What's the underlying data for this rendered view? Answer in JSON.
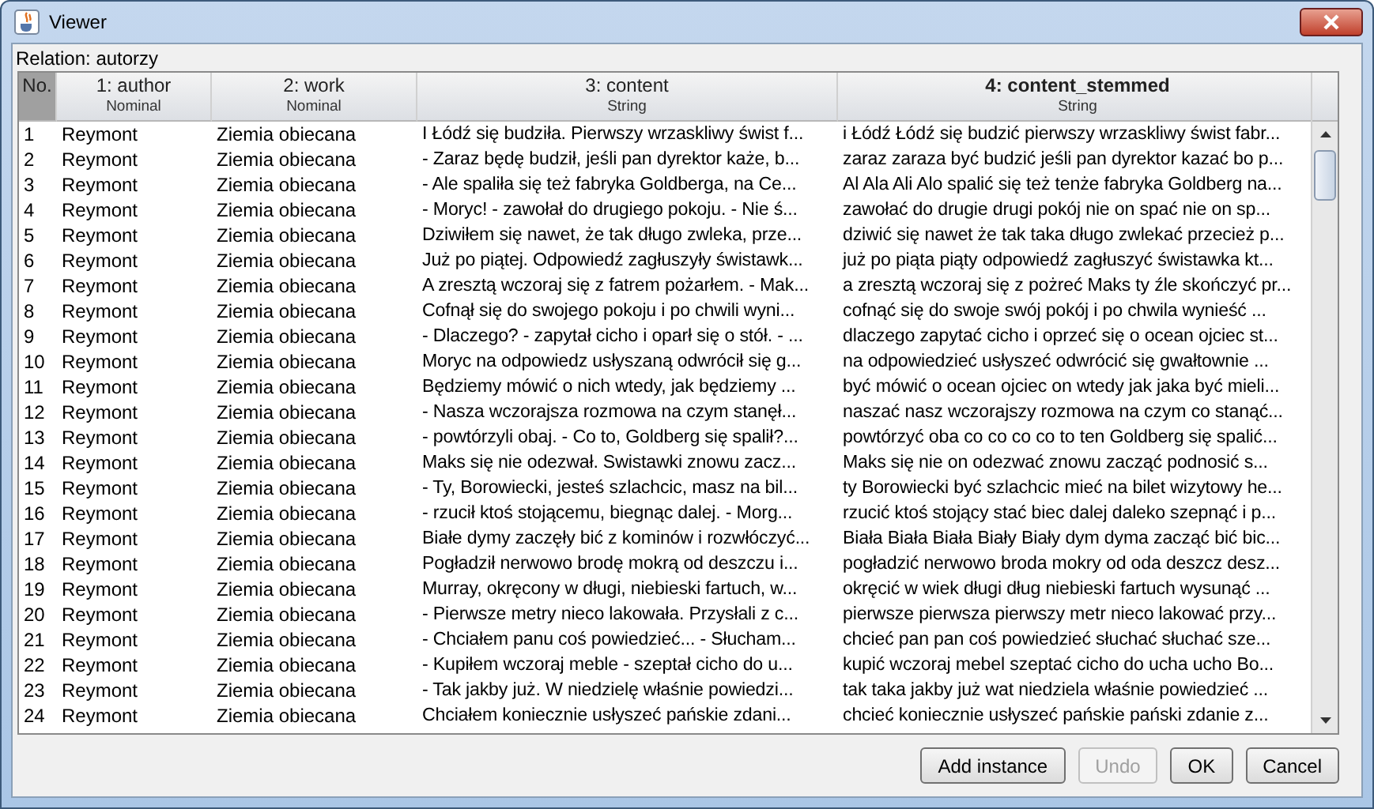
{
  "window": {
    "title": "Viewer"
  },
  "relation": "Relation: autorzy",
  "table": {
    "columns": [
      {
        "name": "No.",
        "selected": false
      },
      {
        "name": "1: author",
        "type": "Nominal",
        "selected": false
      },
      {
        "name": "2: work",
        "type": "Nominal",
        "selected": false
      },
      {
        "name": "3: content",
        "type": "String",
        "selected": false
      },
      {
        "name": "4: content_stemmed",
        "type": "String",
        "selected": true
      }
    ],
    "rows": [
      [
        "1",
        "Reymont",
        "Ziemia obiecana",
        "I Łódź się budziła. Pierwszy wrzaskliwy świst f...",
        "i Łódź Łódź się budzić pierwszy wrzaskliwy świst fabr..."
      ],
      [
        "2",
        "Reymont",
        "Ziemia obiecana",
        "- Zaraz będę budził, jeśli pan dyrektor każe, b...",
        "zaraz zaraza być budzić jeśli pan dyrektor kazać bo p..."
      ],
      [
        "3",
        "Reymont",
        "Ziemia obiecana",
        "- Ale spaliła się też fabryka Goldberga, na Ce...",
        "Al Ala Ali Alo spalić się też tenże fabryka Goldberg na..."
      ],
      [
        "4",
        "Reymont",
        "Ziemia obiecana",
        "- Moryc! - zawołał do drugiego pokoju. - Nie ś...",
        "zawołać do drugie drugi pokój nie on spać nie on sp..."
      ],
      [
        "5",
        "Reymont",
        "Ziemia obiecana",
        "Dziwiłem się nawet, że tak długo zwleka, prze...",
        "dziwić się nawet że tak taka długo zwlekać przecież p..."
      ],
      [
        "6",
        "Reymont",
        "Ziemia obiecana",
        "Już po piątej. Odpowiedź zagłuszyły świstawk...",
        "już po piąta piąty odpowiedź zagłuszyć świstawka kt..."
      ],
      [
        "7",
        "Reymont",
        "Ziemia obiecana",
        "A zresztą wczoraj się z fatrem pożarłem. - Mak...",
        "a zresztą wczoraj się z pożreć Maks ty źle skończyć pr..."
      ],
      [
        "8",
        "Reymont",
        "Ziemia obiecana",
        "Cofnął się do swojego pokoju i po chwili wyni...",
        "cofnąć się do swoje swój pokój i po chwila wynieść ..."
      ],
      [
        "9",
        "Reymont",
        "Ziemia obiecana",
        "- Dlaczego? - zapytał cicho i oparł się o stół. - ...",
        "dlaczego zapytać cicho i oprzeć się o ocean ojciec st..."
      ],
      [
        "10",
        "Reymont",
        "Ziemia obiecana",
        "Moryc na odpowiedz usłyszaną odwrócił się g...",
        "na odpowiedzieć usłyszeć odwrócić się gwałtownie ..."
      ],
      [
        "11",
        "Reymont",
        "Ziemia obiecana",
        "Będziemy mówić o nich wtedy, jak będziemy ...",
        "być mówić o ocean ojciec on wtedy jak jaka być mieli..."
      ],
      [
        "12",
        "Reymont",
        "Ziemia obiecana",
        "- Nasza wczorajsza rozmowa na czym stanęł...",
        "naszać nasz wczorajszy rozmowa na czym co stanąć..."
      ],
      [
        "13",
        "Reymont",
        "Ziemia obiecana",
        "- powtórzyli obaj. - Co to, Goldberg się spalił?...",
        "powtórzyć oba co co co co to ten Goldberg się spalić..."
      ],
      [
        "14",
        "Reymont",
        "Ziemia obiecana",
        "Maks się nie odezwał. Swistawki znowu zacz...",
        "Maks się nie on odezwać znowu zacząć podnosić s..."
      ],
      [
        "15",
        "Reymont",
        "Ziemia obiecana",
        "- Ty, Borowiecki, jesteś szlachcic, masz na bil...",
        "ty Borowiecki być szlachcic mieć na bilet wizytowy he..."
      ],
      [
        "16",
        "Reymont",
        "Ziemia obiecana",
        "- rzucił ktoś stojącemu, biegnąc dalej. - Morg...",
        "rzucić ktoś stojący stać biec dalej daleko szepnąć i p..."
      ],
      [
        "17",
        "Reymont",
        "Ziemia obiecana",
        "Białe dymy zaczęły bić z kominów i rozwłóczyć...",
        "Biała Biała Biała Biały Biały dym dyma zacząć bić bic..."
      ],
      [
        "18",
        "Reymont",
        "Ziemia obiecana",
        "Pogładził nerwowo brodę mokrą od deszczu i...",
        "pogładzić nerwowo broda mokry od oda deszcz desz..."
      ],
      [
        "19",
        "Reymont",
        "Ziemia obiecana",
        "Murray, okręcony w długi, niebieski fartuch, w...",
        "okręcić w wiek długi dług niebieski fartuch wysunąć ..."
      ],
      [
        "20",
        "Reymont",
        "Ziemia obiecana",
        "- Pierwsze metry nieco lakowała. Przysłali z c...",
        "pierwsze pierwsza pierwszy metr nieco lakować przy..."
      ],
      [
        "21",
        "Reymont",
        "Ziemia obiecana",
        "- Chciałem panu coś powiedzieć... - Słucham...",
        "chcieć pan pan coś powiedzieć słuchać słuchać sze..."
      ],
      [
        "22",
        "Reymont",
        "Ziemia obiecana",
        "- Kupiłem wczoraj meble - szeptał cicho do u...",
        "kupić wczoraj mebel szeptać cicho do ucha ucho Bo..."
      ],
      [
        "23",
        "Reymont",
        "Ziemia obiecana",
        "- Tak jakby już. W niedzielę właśnie powiedzi...",
        "tak taka jakby już wat niedziela właśnie powiedzieć ..."
      ],
      [
        "24",
        "Reymont",
        "Ziemia obiecana",
        "Chciałem koniecznie usłyszeć pańskie zdani...",
        "chcieć koniecznie usłyszeć pańskie pański zdanie z..."
      ]
    ]
  },
  "buttons": [
    {
      "label": "Add instance",
      "disabled": false
    },
    {
      "label": "Undo",
      "disabled": true
    },
    {
      "label": "OK",
      "disabled": false
    },
    {
      "label": "Cancel",
      "disabled": false
    }
  ]
}
